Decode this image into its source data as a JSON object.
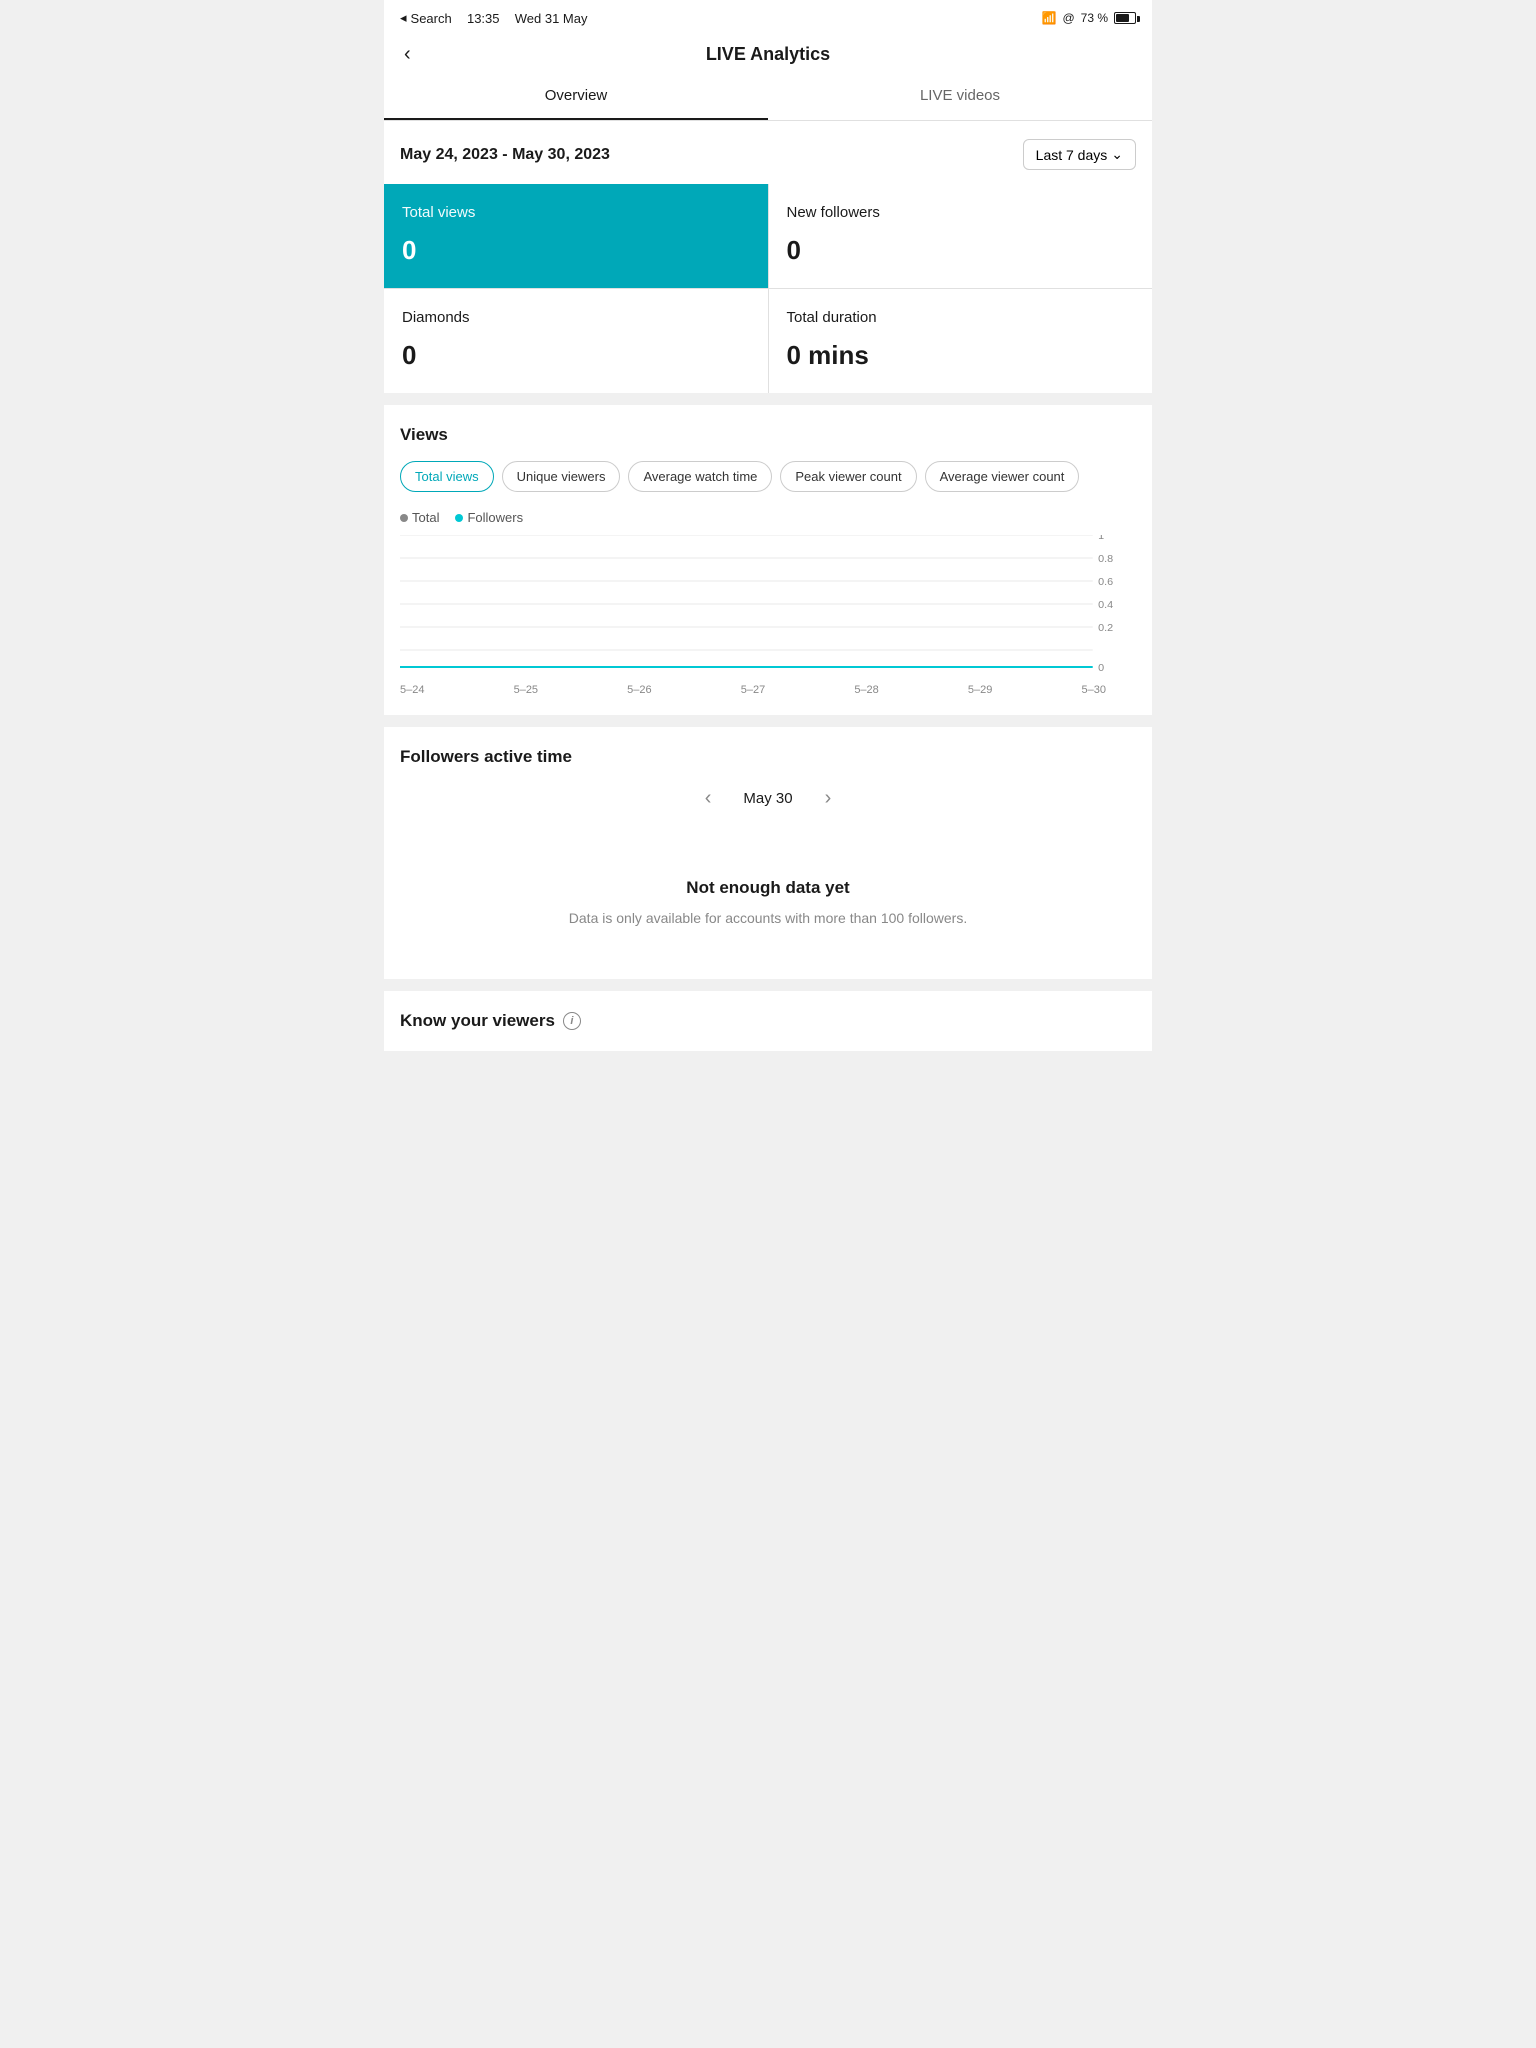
{
  "statusBar": {
    "left": "Search",
    "time": "13:35",
    "date": "Wed 31 May",
    "wifi": "wifi",
    "location": "@",
    "battery": "73 %"
  },
  "header": {
    "title": "LIVE Analytics",
    "backLabel": "‹"
  },
  "tabs": [
    {
      "id": "overview",
      "label": "Overview",
      "active": true
    },
    {
      "id": "live-videos",
      "label": "LIVE videos",
      "active": false
    }
  ],
  "dateRange": {
    "text": "May 24, 2023 - May 30, 2023",
    "filterLabel": "Last 7 days",
    "filterArrow": "∨"
  },
  "stats": [
    {
      "id": "total-views",
      "label": "Total views",
      "value": "0",
      "teal": true
    },
    {
      "id": "new-followers",
      "label": "New followers",
      "value": "0",
      "teal": false
    },
    {
      "id": "diamonds",
      "label": "Diamonds",
      "value": "0",
      "teal": false
    },
    {
      "id": "total-duration",
      "label": "Total duration",
      "value": "0 mins",
      "teal": false
    }
  ],
  "views": {
    "sectionTitle": "Views",
    "pills": [
      {
        "id": "total-views",
        "label": "Total views",
        "active": true
      },
      {
        "id": "unique-viewers",
        "label": "Unique viewers",
        "active": false
      },
      {
        "id": "avg-watch-time",
        "label": "Average watch time",
        "active": false
      },
      {
        "id": "peak-viewer-count",
        "label": "Peak viewer count",
        "active": false
      },
      {
        "id": "avg-viewer-count",
        "label": "Average viewer count",
        "active": false
      }
    ],
    "legend": [
      {
        "id": "total",
        "label": "Total",
        "color": "#888"
      },
      {
        "id": "followers",
        "label": "Followers",
        "color": "#00c8d4"
      }
    ],
    "yLabels": [
      "1",
      "0.8",
      "0.6",
      "0.4",
      "0.2",
      "0"
    ],
    "xLabels": [
      "5–24",
      "5–25",
      "5–26",
      "5–27",
      "5–28",
      "5–29",
      "5–30"
    ]
  },
  "followersActiveTime": {
    "sectionTitle": "Followers active time",
    "navDate": "May 30",
    "prevArrow": "‹",
    "nextArrow": "›",
    "noDataTitle": "Not enough data yet",
    "noDataSubtitle": "Data is only available for accounts with more than 100 followers."
  },
  "knowYourViewers": {
    "title": "Know your viewers",
    "infoIcon": "i"
  }
}
